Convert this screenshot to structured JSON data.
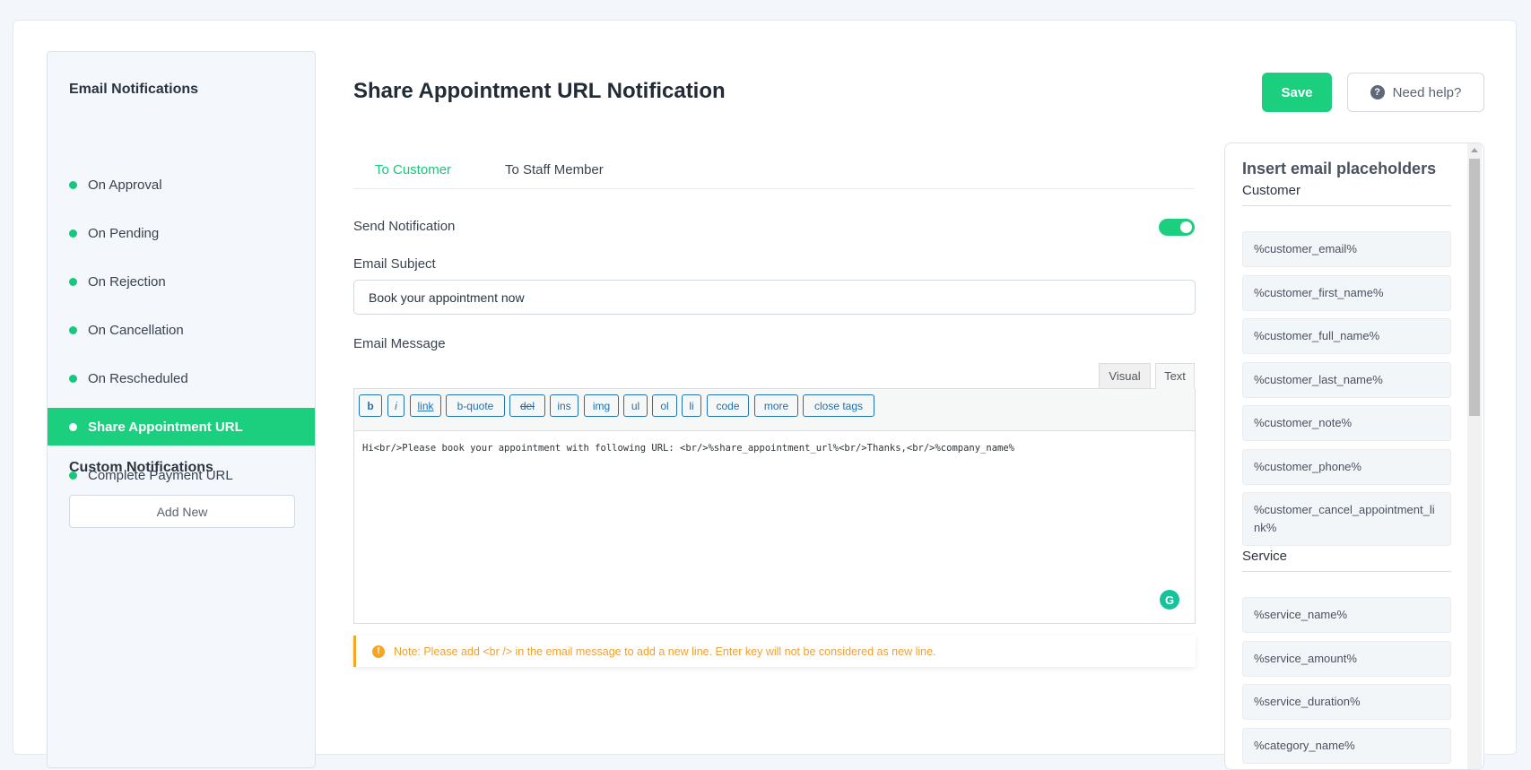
{
  "colors": {
    "accent": "#1ccf7e",
    "note": "#f0a030"
  },
  "sidebar": {
    "email_heading": "Email Notifications",
    "items": [
      {
        "label": "On Approval"
      },
      {
        "label": "On Pending"
      },
      {
        "label": "On Rejection"
      },
      {
        "label": "On Cancellation"
      },
      {
        "label": "On Rescheduled"
      },
      {
        "label": "Share Appointment URL",
        "active": true
      },
      {
        "label": "Complete Payment URL"
      }
    ],
    "custom_heading": "Custom Notifications",
    "add_new": "Add New"
  },
  "header": {
    "title": "Share Appointment URL Notification",
    "save": "Save",
    "help": "Need help?",
    "help_icon": "?"
  },
  "tabs": [
    {
      "label": "To Customer",
      "active": true
    },
    {
      "label": "To Staff Member"
    }
  ],
  "form": {
    "send_notification": "Send Notification",
    "send_enabled": true,
    "subject_label": "Email Subject",
    "subject_value": "Book your appointment now",
    "message_label": "Email Message",
    "editor_tabs": [
      "Visual",
      "Text"
    ],
    "active_editor_tab": "Text",
    "toolbar": [
      "b",
      "i",
      "link",
      "b-quote",
      "del",
      "ins",
      "img",
      "ul",
      "ol",
      "li",
      "code",
      "more",
      "close tags"
    ],
    "message_value": "Hi<br/>Please book your appointment with following URL: <br/>%share_appointment_url%<br/>Thanks,<br/>%company_name%",
    "note": "Note: Please add <br /> in the email message to add a new line. Enter key will not be considered as new line."
  },
  "placeholders": {
    "title": "Insert email placeholders",
    "groups": [
      {
        "label": "Customer",
        "items": [
          "%customer_email%",
          "%customer_first_name%",
          "%customer_full_name%",
          "%customer_last_name%",
          "%customer_note%",
          "%customer_phone%",
          "%customer_cancel_appointment_link%"
        ]
      },
      {
        "label": "Service",
        "items": [
          "%service_name%",
          "%service_amount%",
          "%service_duration%",
          "%category_name%"
        ]
      }
    ]
  }
}
